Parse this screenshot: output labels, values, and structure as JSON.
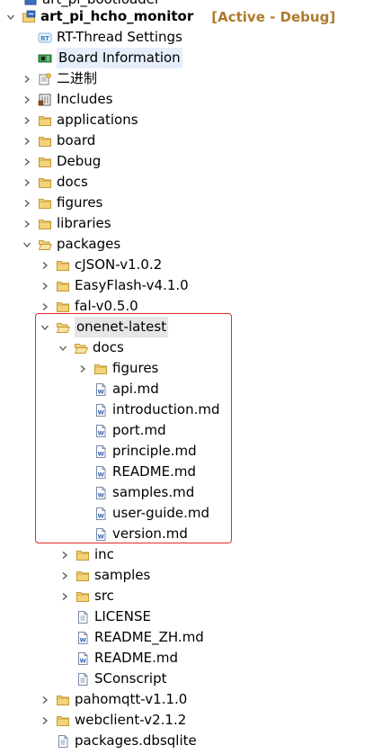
{
  "colors": {
    "folder_fill": "#f3d27a",
    "folder_stroke": "#c39a30",
    "project_suffix": "#b07a2b",
    "highlight_border": "#e02828"
  },
  "tree": {
    "top_clipped": "art_pi_bootloader",
    "project": {
      "name": "art_pi_hcho_monitor",
      "suffix": "[Active - Debug]"
    },
    "rt_thread_settings": "RT-Thread Settings",
    "board_information": "Board Information",
    "binaries": "二进制",
    "includes": "Includes",
    "applications": "applications",
    "board": "board",
    "debug": "Debug",
    "docs": "docs",
    "figures": "figures",
    "libraries": "libraries",
    "packages": {
      "label": "packages",
      "cjson": "cJSON-v1.0.2",
      "easyflash": "EasyFlash-v4.1.0",
      "fal": "fal-v0.5.0",
      "onenet": {
        "label": "onenet-latest",
        "docs": {
          "label": "docs",
          "figures": "figures",
          "files": [
            "api.md",
            "introduction.md",
            "port.md",
            "principle.md",
            "README.md",
            "samples.md",
            "user-guide.md",
            "version.md"
          ]
        },
        "inc": "inc",
        "samples": "samples",
        "src": "src",
        "files": [
          "LICENSE",
          "README_ZH.md",
          "README.md",
          "SConscript"
        ]
      },
      "pahomqtt": "pahomqtt-v1.1.0",
      "webclient": "webclient-v2.1.2",
      "dbsqlite": "packages.dbsqlite"
    }
  }
}
